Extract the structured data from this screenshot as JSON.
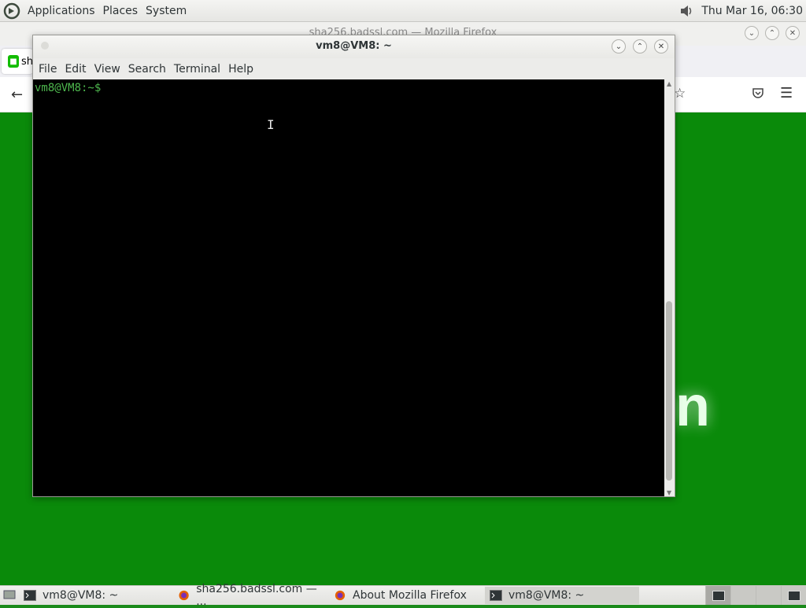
{
  "top_panel": {
    "menus": [
      "Applications",
      "Places",
      "System"
    ],
    "clock": "Thu Mar 16, 06:30"
  },
  "firefox": {
    "title": "sha256.badssl.com — Mozilla Firefox",
    "tab_text": "sh",
    "page_glyph": "n",
    "accent": "#0a8a0a"
  },
  "terminal": {
    "title": "vm8@VM8: ~",
    "menus": [
      "File",
      "Edit",
      "View",
      "Search",
      "Terminal",
      "Help"
    ],
    "prompt": "vm8@VM8:~$",
    "prompt_color": "#4eb84e"
  },
  "taskbar": {
    "tasks": [
      {
        "label": "vm8@VM8: ~",
        "icon": "terminal-icon"
      },
      {
        "label": "sha256.badssl.com — ...",
        "icon": "firefox-icon"
      },
      {
        "label": "About Mozilla Firefox",
        "icon": "firefox-icon"
      },
      {
        "label": "vm8@VM8: ~",
        "icon": "terminal-icon"
      }
    ]
  }
}
